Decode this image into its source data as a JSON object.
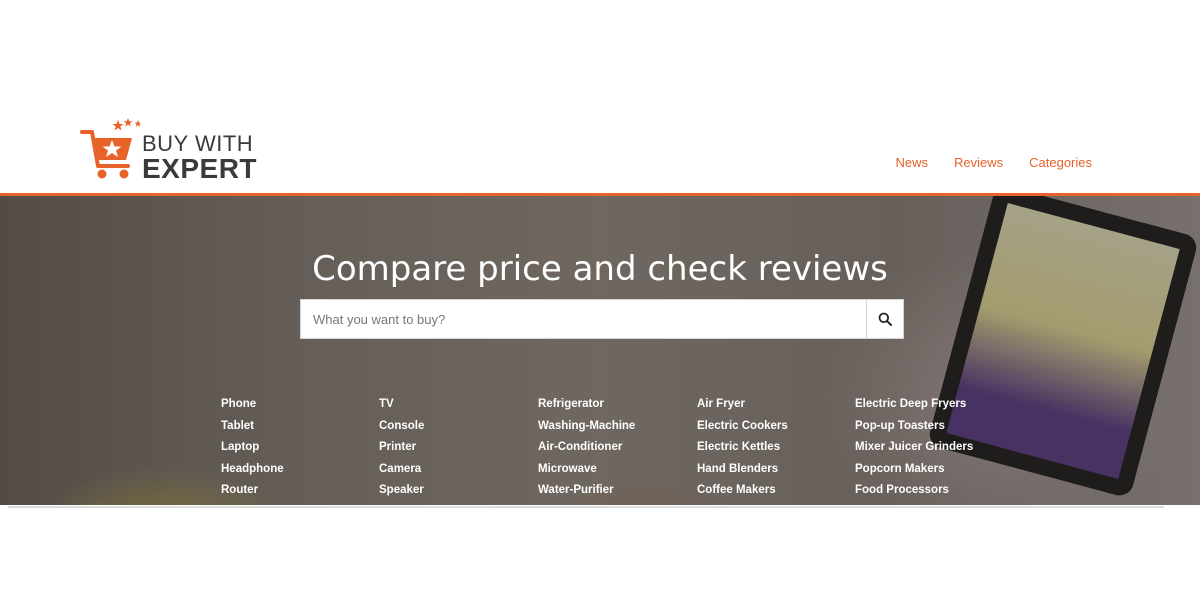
{
  "brand": {
    "line1": "BUY WITH",
    "line2": "EXPERT",
    "accent_color": "#e8622a",
    "icon": "shopping-cart-star-logo"
  },
  "nav": {
    "items": [
      {
        "label": "News"
      },
      {
        "label": "Reviews"
      },
      {
        "label": "Categories"
      }
    ]
  },
  "hero": {
    "title": "Compare price and check reviews",
    "search": {
      "placeholder": "What you want to buy?",
      "value": "",
      "button_icon": "search-icon"
    }
  },
  "categories": {
    "columns": [
      [
        "Phone",
        "Tablet",
        "Laptop",
        "Headphone",
        "Router"
      ],
      [
        "TV",
        "Console",
        "Printer",
        "Camera",
        "Speaker"
      ],
      [
        "Refrigerator",
        "Washing-Machine",
        "Air-Conditioner",
        "Microwave",
        "Water-Purifier"
      ],
      [
        "Air Fryer",
        "Electric Cookers",
        "Electric Kettles",
        "Hand Blenders",
        "Coffee Makers"
      ],
      [
        "Electric Deep Fryers",
        "Pop-up Toasters",
        "Mixer Juicer Grinders",
        "Popcorn Makers",
        "Food Processors"
      ]
    ]
  }
}
